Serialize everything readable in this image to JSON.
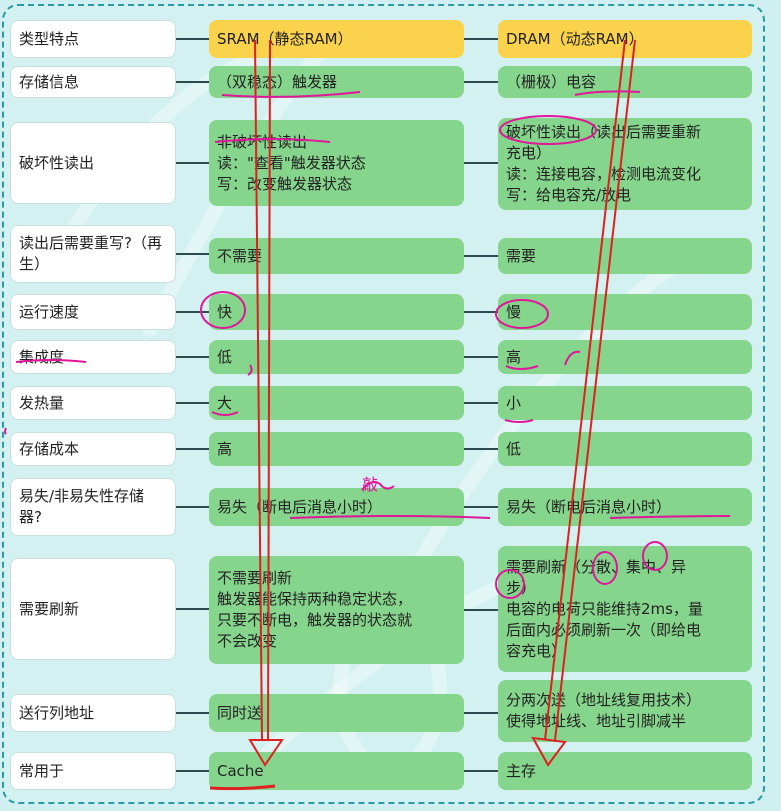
{
  "colors": {
    "label_bg": "#ffffff",
    "cell_bg": "#86d58c",
    "header_bg": "#fbd24b",
    "connector": "#2b4a4f",
    "annotation_red": "#e02020",
    "annotation_magenta": "#e0169b"
  },
  "annotations": {
    "handwritten_note": "敲"
  },
  "rows": [
    {
      "label": "类型特点",
      "sram": [
        "SRAM（静态RAM）"
      ],
      "dram": [
        "DRAM（动态RAM）"
      ]
    },
    {
      "label": "存储信息",
      "sram": [
        "（双稳态）触发器"
      ],
      "dram": [
        "（栅极）电容"
      ]
    },
    {
      "label": "破坏性读出",
      "sram": [
        "非破坏性读出",
        "读：\"查看\"触发器状态",
        "写：改变触发器状态"
      ],
      "dram": [
        "破坏性读出（读出后需要重新",
        "充电）",
        "读：连接电容，检测电流变化",
        "写：给电容充/放电"
      ]
    },
    {
      "label": "读出后需要重写?（再生）",
      "sram": [
        "不需要"
      ],
      "dram": [
        "需要"
      ]
    },
    {
      "label": "运行速度",
      "sram": [
        "快"
      ],
      "dram": [
        "慢"
      ]
    },
    {
      "label": "集成度",
      "sram": [
        "低"
      ],
      "dram": [
        "高"
      ]
    },
    {
      "label": "发热量",
      "sram": [
        "大"
      ],
      "dram": [
        "小"
      ]
    },
    {
      "label": "存储成本",
      "sram": [
        "高"
      ],
      "dram": [
        "低"
      ]
    },
    {
      "label": "易失/非易失性存储器?",
      "sram": [
        "易失（断电后消息小时）"
      ],
      "dram": [
        "易失（断电后消息小时）"
      ]
    },
    {
      "label": "需要刷新",
      "sram": [
        "不需要刷新",
        "触发器能保持两种稳定状态，",
        "只要不断电，触发器的状态就",
        "不会改变"
      ],
      "dram": [
        "需要刷新（分散、集中、异",
        "步）",
        "电容的电荷只能维持2ms，量",
        "后面内必须刷新一次（即给电",
        "容充电）"
      ]
    },
    {
      "label": "送行列地址",
      "sram": [
        "同时送"
      ],
      "dram": [
        "分两次送（地址线复用技术）",
        "使得地址线、地址引脚减半"
      ]
    },
    {
      "label": "常用于",
      "sram": [
        "Cache"
      ],
      "dram": [
        "主存"
      ]
    }
  ]
}
